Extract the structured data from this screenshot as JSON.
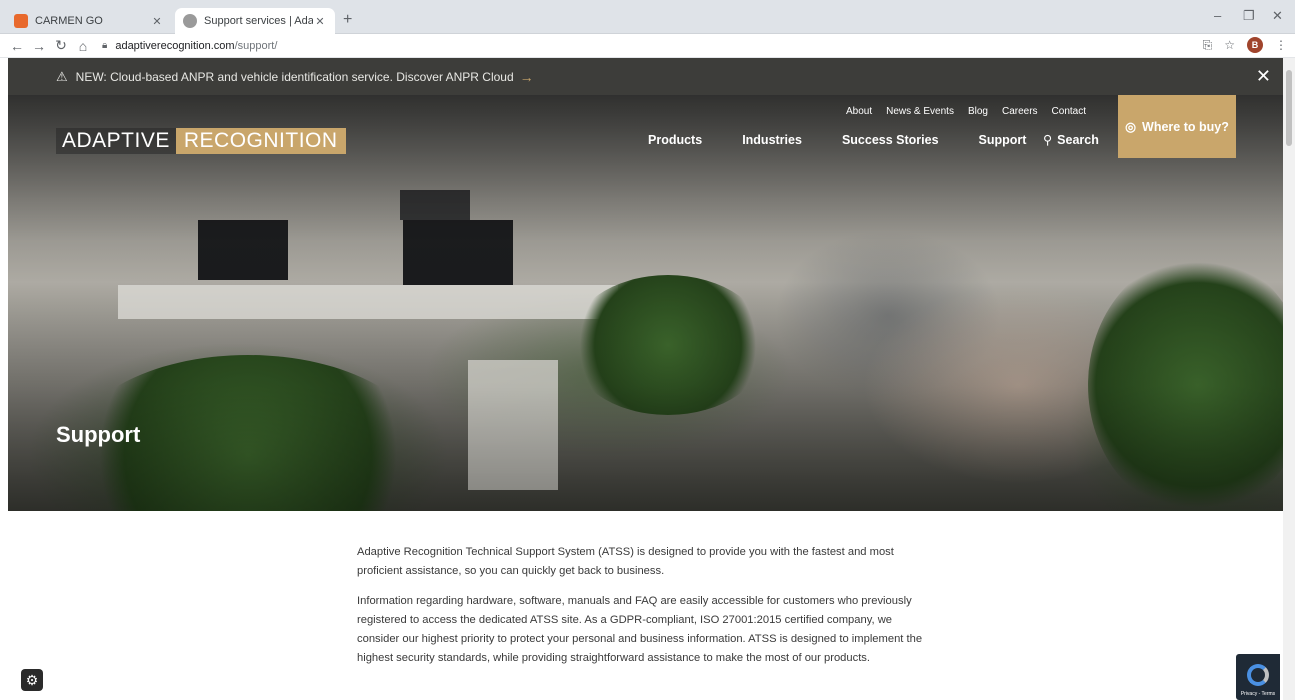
{
  "browser": {
    "tabs": [
      {
        "title": "CARMEN GO",
        "favicon_color": "#e8692c",
        "active": false
      },
      {
        "title": "Support services | Adaptive Reco",
        "favicon_color": "#8a8a8a",
        "active": true
      }
    ],
    "new_tab": "+",
    "window_controls": {
      "minimize": "–",
      "restore": "❐",
      "close": "✕"
    },
    "url_host": "adaptiverecognition.com",
    "url_path": "/support/",
    "profile_initial": "B"
  },
  "announcement": {
    "text": "NEW: Cloud-based ANPR and vehicle identification service. Discover ANPR Cloud",
    "arrow": "→",
    "close": "✕"
  },
  "header": {
    "logo_part1": "ADAPTIVE",
    "logo_part2": "RECOGNITION",
    "top_links": [
      "About",
      "News & Events",
      "Blog",
      "Careers",
      "Contact"
    ],
    "main_links": [
      "Products",
      "Industries",
      "Success Stories",
      "Support"
    ],
    "search": "Search",
    "where_to_buy": "Where to buy?"
  },
  "hero": {
    "title": "Support"
  },
  "content": {
    "paragraphs": [
      "Adaptive Recognition Technical Support System (ATSS) is designed to provide you with the fastest and most proficient assistance, so you can quickly get back to business.",
      "Information regarding hardware, software, manuals and FAQ are easily accessible for customers who previously registered to access the dedicated ATSS site. As a GDPR-compliant, ISO 27001:2015 certified company, we consider our highest priority to protect your personal and business information. ATSS is designed to implement the highest security standards, while providing straightforward assistance to make the most of our products."
    ]
  },
  "recaptcha": {
    "text": "Privacy - Terms"
  },
  "colors": {
    "accent": "#c9a66b",
    "banner_bg": "#3d3d3a"
  }
}
